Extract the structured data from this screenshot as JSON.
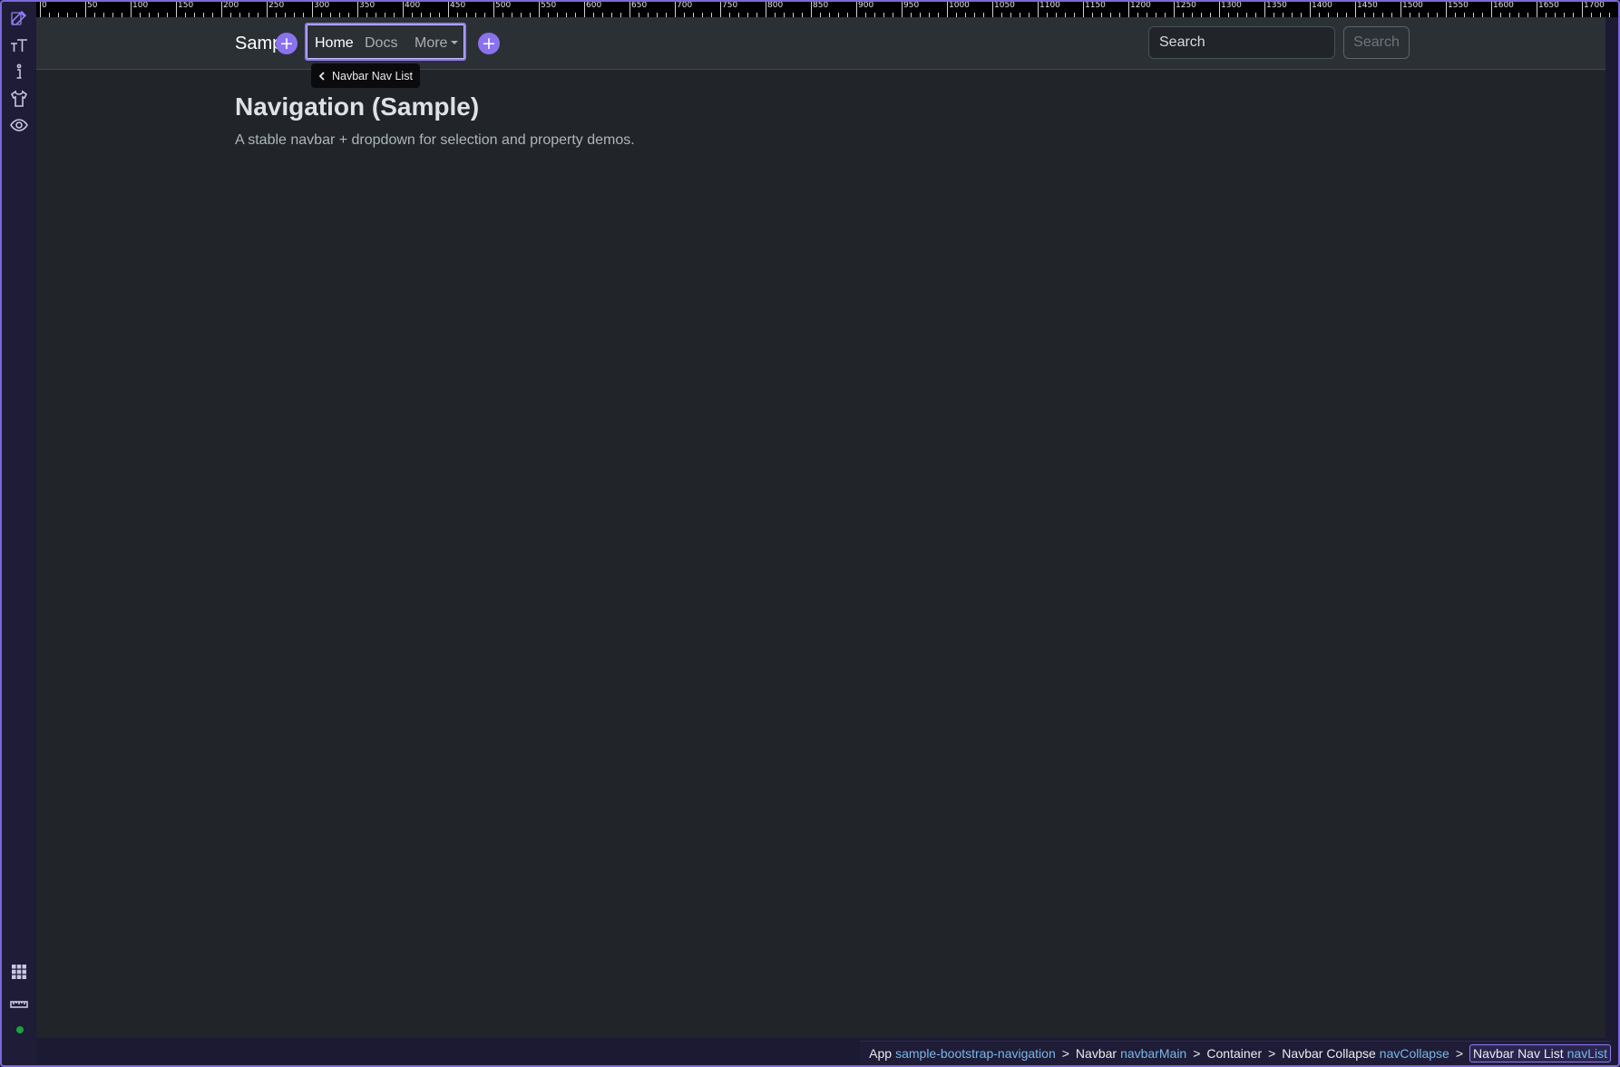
{
  "canvas": {
    "brand": "Sample",
    "nav_links": [
      "Home",
      "Docs",
      "More"
    ],
    "search": {
      "placeholder": "Search",
      "button_label": "Search"
    },
    "selection_tooltip": "Navbar Nav List",
    "page_title": "Navigation (Sample)",
    "page_subtitle": "A stable navbar + dropdown for selection and property demos.",
    "add_button_glyph": "+"
  },
  "tools": [
    "edit-icon",
    "text-size-icon",
    "info-icon",
    "style-icon",
    "eye-icon",
    "grid-icon",
    "ruler-icon"
  ],
  "breadcrumb": [
    {
      "type": "App",
      "id": "sample-bootstrap-navigation"
    },
    {
      "type": "Navbar",
      "id": "navbarMain"
    },
    {
      "type": "Container",
      "id": ""
    },
    {
      "type": "Navbar Collapse",
      "id": "navCollapse"
    },
    {
      "type": "Navbar Nav List",
      "id": "navList"
    }
  ],
  "breadcrumb_separator": ">",
  "ruler_labels": [
    "0",
    "50",
    "100",
    "150",
    "200",
    "250",
    "300",
    "350",
    "400",
    "450",
    "500",
    "550",
    "600",
    "650",
    "700",
    "750",
    "800",
    "850",
    "900",
    "950",
    "1000",
    "1050",
    "1100",
    "1150",
    "1200",
    "1250",
    "1300",
    "1350",
    "1400",
    "1450",
    "1500",
    "1550",
    "1600",
    "1650",
    "1700"
  ],
  "colors": {
    "accent": "#8a72ee",
    "canvas_bg": "#212529",
    "navbar_bg": "#2b3035",
    "rail_bg": "#1e1c36",
    "status_ok": "#1aa33a"
  }
}
